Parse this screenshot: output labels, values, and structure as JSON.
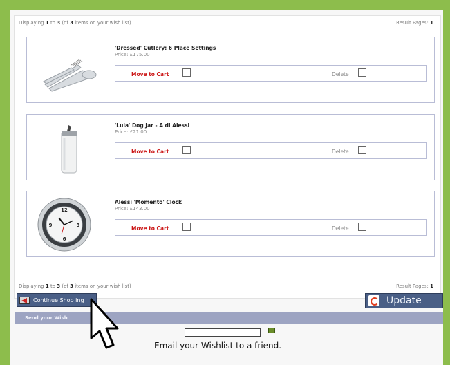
{
  "summary": {
    "prefix": "Displaying",
    "from": "1",
    "to_word": "to",
    "to": "3",
    "of_prefix": "(of",
    "total": "3",
    "suffix": "items on your wish list)",
    "pages_label": "Result Pages:",
    "page": "1"
  },
  "items": [
    {
      "title": "'Dressed' Cutlery: 6 Place Settings",
      "price": "Price:  £175.00",
      "move_label": "Move to Cart",
      "delete_label": "Delete"
    },
    {
      "title": "'Lula' Dog Jar - A di Alessi",
      "price": "Price:  £21.00",
      "move_label": "Move to Cart",
      "delete_label": "Delete"
    },
    {
      "title": "Alessi 'Momento' Clock",
      "price": "Price:  £143.00",
      "move_label": "Move to Cart",
      "delete_label": "Delete"
    }
  ],
  "buttons": {
    "continue_label": "Continue Shop  ing",
    "update_label": "Update"
  },
  "send_section": {
    "header": "Send your Wish",
    "email_text": "Email your Wishlist to a friend.",
    "email_value": ""
  },
  "colors": {
    "background": "#8dbd4c",
    "button": "#4a5f86",
    "move_to_cart": "#cc1a1a",
    "border": "#b9bdd6"
  },
  "icons": [
    "arrow-left-icon",
    "refresh-icon",
    "mail-icon",
    "mouse-pointer-icon"
  ]
}
